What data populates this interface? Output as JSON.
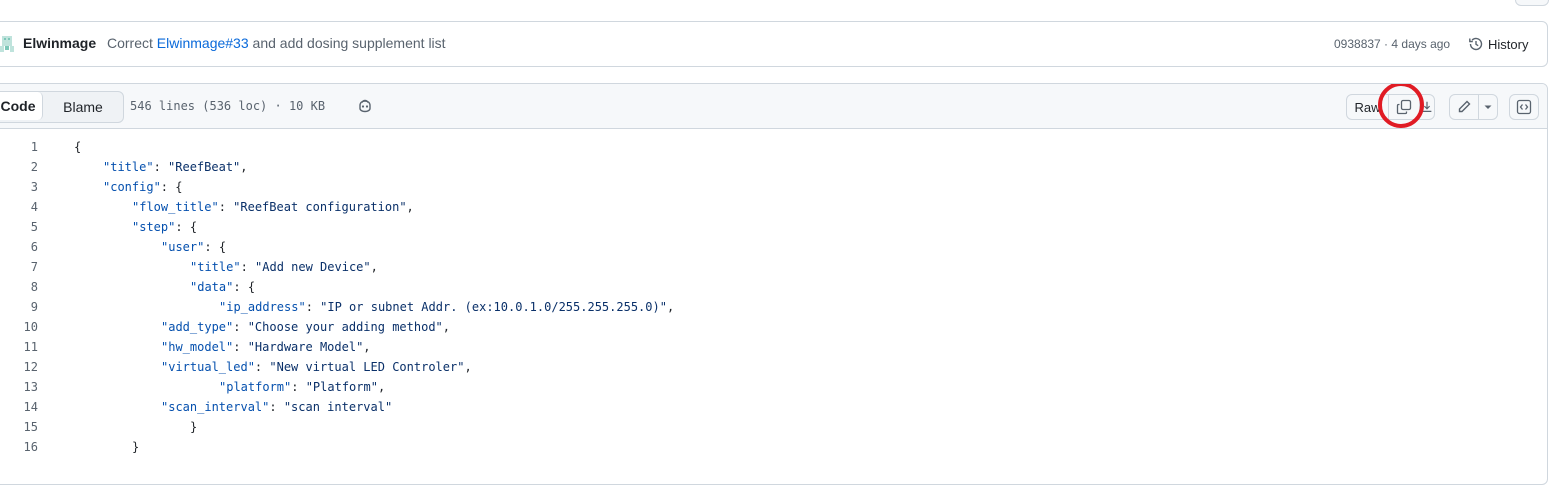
{
  "commit": {
    "author": "Elwinmage",
    "message_prefix": "Correct",
    "message_link": "Elwinmage#33",
    "message_suffix": "and add dosing supplement list",
    "sha_time": "0938837 · 4 days ago",
    "history_label": "History"
  },
  "file_header": {
    "tab_code": "Code",
    "tab_blame": "Blame",
    "info": "546 lines (536 loc) · 10 KB",
    "raw_label": "Raw"
  },
  "icons": {
    "avatar": "avatar-icon",
    "history": "history-icon",
    "copilot": "copilot-icon",
    "copy": "copy-icon",
    "download": "download-icon",
    "edit": "pencil-icon",
    "dropdown": "triangle-down-icon",
    "symbols": "code-square-icon"
  },
  "colors": {
    "link": "#0969da",
    "json_key": "#0550ae",
    "json_string": "#0a3069",
    "highlight_ring": "#e01b24"
  },
  "code_lines": [
    {
      "n": "1",
      "indent": 0,
      "key": "",
      "sep": "",
      "value": "",
      "tail": "{"
    },
    {
      "n": "2",
      "indent": 1,
      "key": "\"title\"",
      "sep": ": ",
      "value": "\"ReefBeat\"",
      "tail": ","
    },
    {
      "n": "3",
      "indent": 1,
      "key": "\"config\"",
      "sep": ": ",
      "value": "",
      "tail": "{"
    },
    {
      "n": "4",
      "indent": 2,
      "key": "\"flow_title\"",
      "sep": ": ",
      "value": "\"ReefBeat configuration\"",
      "tail": ","
    },
    {
      "n": "5",
      "indent": 2,
      "key": "\"step\"",
      "sep": ": ",
      "value": "",
      "tail": "{"
    },
    {
      "n": "6",
      "indent": 3,
      "key": "\"user\"",
      "sep": ": ",
      "value": "",
      "tail": "{"
    },
    {
      "n": "7",
      "indent": 4,
      "key": "\"title\"",
      "sep": ": ",
      "value": "\"Add new Device\"",
      "tail": ","
    },
    {
      "n": "8",
      "indent": 4,
      "key": "\"data\"",
      "sep": ": ",
      "value": "",
      "tail": "{"
    },
    {
      "n": "9",
      "indent": 5,
      "key": "\"ip_address\"",
      "sep": ": ",
      "value": "\"IP or subnet Addr. (ex:10.0.1.0/255.255.255.0)\"",
      "tail": ","
    },
    {
      "n": "10",
      "indent": 3,
      "key": "\"add_type\"",
      "sep": ": ",
      "value": "\"Choose your adding method\"",
      "tail": ","
    },
    {
      "n": "11",
      "indent": 3,
      "key": "\"hw_model\"",
      "sep": ": ",
      "value": "\"Hardware Model\"",
      "tail": ","
    },
    {
      "n": "12",
      "indent": 3,
      "key": "\"virtual_led\"",
      "sep": ": ",
      "value": "\"New virtual LED Controler\"",
      "tail": ","
    },
    {
      "n": "13",
      "indent": 5,
      "key": "\"platform\"",
      "sep": ": ",
      "value": "\"Platform\"",
      "tail": ","
    },
    {
      "n": "14",
      "indent": 3,
      "key": "\"scan_interval\"",
      "sep": ": ",
      "value": "\"scan interval\"",
      "tail": ""
    },
    {
      "n": "15",
      "indent": 4,
      "key": "",
      "sep": "",
      "value": "",
      "tail": "}"
    },
    {
      "n": "16",
      "indent": 2,
      "key": "",
      "sep": "",
      "value": "",
      "tail": "}"
    }
  ]
}
